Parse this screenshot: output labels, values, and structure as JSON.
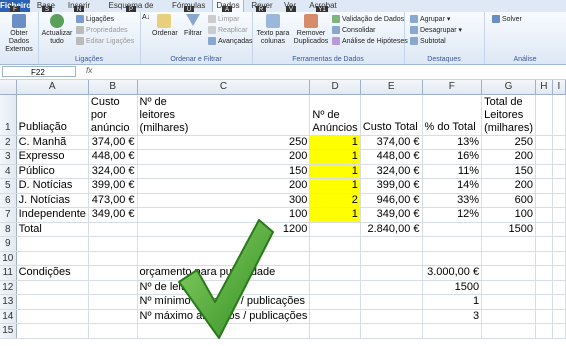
{
  "ribbon_tabs": [
    "Ficheiro",
    "Base",
    "Inserir",
    "Esquema de Página",
    "Fórmulas",
    "Dados",
    "Rever",
    "Ver",
    "Acrobat"
  ],
  "keytips": [
    "F",
    "S",
    "N",
    "P",
    "U",
    "A",
    "R",
    "V",
    "Y1"
  ],
  "ribbon": {
    "obter_dados": "Obter Dados Externos",
    "actualizar": "Actualizar tudo",
    "ligacoes": "Ligações",
    "propriedades": "Propriedades",
    "editar_ligacoes": "Editar Ligações",
    "group_ligacoes": "Ligações",
    "ordenar": "Ordenar",
    "filtrar": "Filtrar",
    "limpar": "Limpar",
    "reaplicar": "Reaplicar",
    "avancadas": "Avançadas",
    "group_ordenar": "Ordenar e Filtrar",
    "texto_colunas": "Texto para colunas",
    "remover_dup": "Remover Duplicados",
    "validacao": "Validação de Dados",
    "consolidar": "Consolidar",
    "analise": "Análise de Hipóteses",
    "group_ferramentas": "Ferramentas de Dados",
    "agrupar": "Agrupar",
    "desagrupar": "Desagrupar",
    "subtotal": "Subtotal",
    "group_destaques": "Destaques",
    "solver": "Solver",
    "group_analise": "Análise"
  },
  "name_box": "F22",
  "fx": "fx",
  "columns": [
    "A",
    "B",
    "C",
    "D",
    "E",
    "F",
    "G",
    "H",
    "I"
  ],
  "header_rows": [
    [
      "",
      "",
      "Nº de",
      "",
      "",
      "",
      "Total de",
      "",
      ""
    ],
    [
      "",
      "Custo por",
      "leitores",
      "Nº de",
      "",
      "",
      "Leitores",
      "",
      ""
    ],
    [
      "Publiação",
      "anúncio",
      "(milhares)",
      "Anúncios",
      "Custo Total",
      "% do Total",
      "(milhares)",
      "",
      ""
    ]
  ],
  "rows": [
    {
      "n": "2",
      "a": "C. Manhã",
      "b": "374,00 €",
      "c": "250",
      "d": "1",
      "e": "374,00 €",
      "f": "13%",
      "g": "250"
    },
    {
      "n": "3",
      "a": "Expresso",
      "b": "448,00 €",
      "c": "200",
      "d": "1",
      "e": "448,00 €",
      "f": "16%",
      "g": "200"
    },
    {
      "n": "4",
      "a": "Público",
      "b": "324,00 €",
      "c": "150",
      "d": "1",
      "e": "324,00 €",
      "f": "11%",
      "g": "150"
    },
    {
      "n": "5",
      "a": "D. Notícias",
      "b": "399,00 €",
      "c": "200",
      "d": "1",
      "e": "399,00 €",
      "f": "14%",
      "g": "200"
    },
    {
      "n": "6",
      "a": "J. Notícias",
      "b": "473,00 €",
      "c": "300",
      "d": "2",
      "e": "946,00 €",
      "f": "33%",
      "g": "600"
    },
    {
      "n": "7",
      "a": "Independente",
      "b": "349,00 €",
      "c": "100",
      "d": "1",
      "e": "349,00 €",
      "f": "12%",
      "g": "100"
    }
  ],
  "total": {
    "n": "8",
    "a": "Total",
    "c": "1200",
    "e": "2.840,00 €",
    "g": "1500"
  },
  "cond": {
    "r11_a": "Condições",
    "r11_c": "orçamento para publicidade",
    "r11_f": "3.000,00 €",
    "r12_c": "Nº de leitores",
    "r12_f": "1500",
    "r13_c": "Nº mínimo anúncios / publicações",
    "r13_f": "1",
    "r14_c": "Nº máximo anúncios / publicações",
    "r14_f": "3"
  },
  "colors": {
    "highlight": "#ffff00",
    "check": "#3aa52a",
    "file_tab": "#2a63b6"
  }
}
